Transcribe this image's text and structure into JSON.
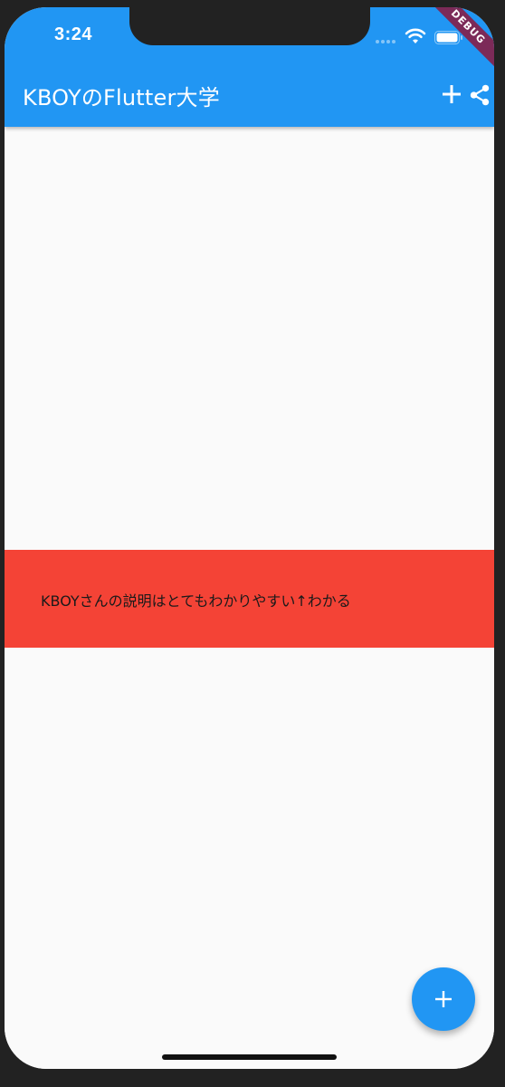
{
  "status_bar": {
    "time": "3:24"
  },
  "debug_banner": "DEBUG",
  "app_bar": {
    "title": "KBOYのFlutter大学",
    "background_color": "#2196f3",
    "actions": [
      "add-icon",
      "share-icon"
    ]
  },
  "content": {
    "card": {
      "text": "KBOYさんの説明はとてもわかりやすい↑わかる",
      "background_color": "#f44336"
    }
  },
  "fab": {
    "icon": "add-icon",
    "color": "#2196f3"
  }
}
